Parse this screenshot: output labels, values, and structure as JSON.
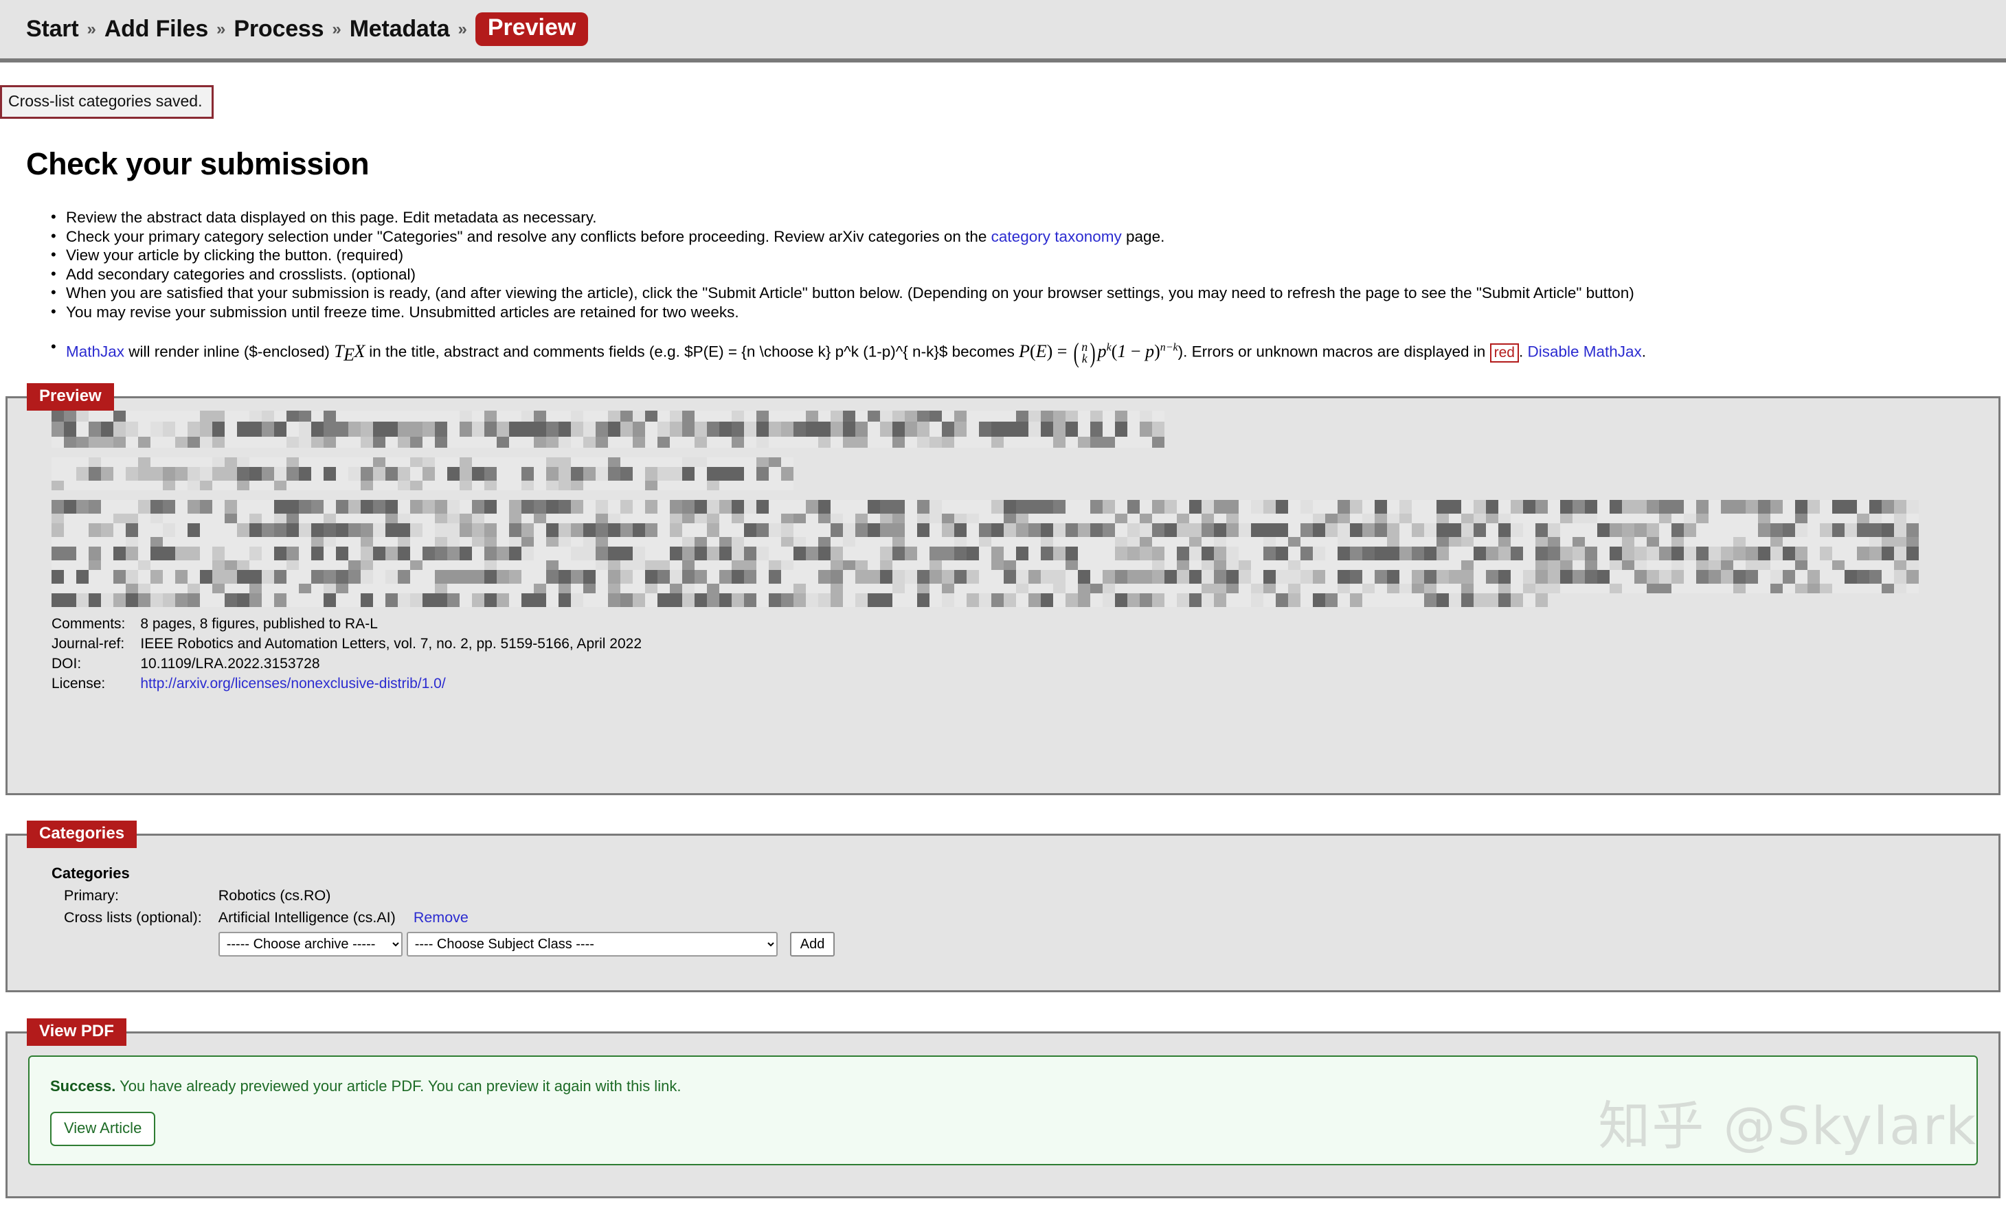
{
  "nav": {
    "separator": "»",
    "steps": [
      {
        "label": "Start",
        "current": false
      },
      {
        "label": "Add Files",
        "current": false
      },
      {
        "label": "Process",
        "current": false
      },
      {
        "label": "Metadata",
        "current": false
      },
      {
        "label": "Preview",
        "current": true
      }
    ]
  },
  "flash": {
    "message": "Cross-list categories saved."
  },
  "page": {
    "title": "Check your submission"
  },
  "instructions": {
    "b1": "Review the abstract data displayed on this page. Edit metadata as necessary.",
    "b2_a": "Check your primary category selection under \"Categories\" and resolve any conflicts before proceeding. Review arXiv categories on the ",
    "b2_link": "category taxonomy",
    "b2_b": " page.",
    "b3": "View your article by clicking the button. (required)",
    "b4": "Add secondary categories and crosslists. (optional)",
    "b5": "When you are satisfied that your submission is ready, (and after viewing the article), click the \"Submit Article\" button below. (Depending on your browser settings, you may need to refresh the page to see the \"Submit Article\" button)",
    "b6": "You may revise your submission until freeze time. Unsubmitted articles are retained for two weeks.",
    "b7_link": "MathJax",
    "b7_a": " will render inline ($-enclosed) ",
    "b7_tex": "TEX",
    "b7_b": " in the title, abstract and comments fields (e.g. $P(E) = {n \\choose k} p^k (1-p)^{ n-k}$ becomes ",
    "b7_formula": "P(E) = (n k) p^k (1 - p)^(n-k)",
    "b7_c": "). Errors or unknown macros are displayed in ",
    "b7_red": "red",
    "b7_d": ". ",
    "b7_link2": "Disable MathJax",
    "b7_e": "."
  },
  "preview_panel": {
    "legend": "Preview",
    "redacted_note": "abstract and title content is pixelated / redacted",
    "metadata": [
      {
        "label": "Comments:",
        "value": "8 pages, 8 figures, published to RA-L",
        "is_link": false
      },
      {
        "label": "Journal-ref:",
        "value": "IEEE Robotics and Automation Letters, vol. 7, no. 2, pp. 5159-5166, April 2022",
        "is_link": false
      },
      {
        "label": "DOI:",
        "value": "10.1109/LRA.2022.3153728",
        "is_link": false
      },
      {
        "label": "License:",
        "value": "http://arxiv.org/licenses/nonexclusive-distrib/1.0/",
        "is_link": true
      }
    ]
  },
  "categories_panel": {
    "legend": "Categories",
    "heading": "Categories",
    "primary_label": "Primary:",
    "primary_value": "Robotics (cs.RO)",
    "crosslist_label": "Cross lists (optional):",
    "crosslist_value": "Artificial Intelligence (cs.AI)",
    "remove_label": "Remove",
    "archive_select": "----- Choose archive -----",
    "subject_select": "---- Choose Subject Class ----",
    "add_label": "Add"
  },
  "viewpdf_panel": {
    "legend": "View PDF",
    "success_strong": "Success.",
    "success_text": " You have already previewed your article PDF. You can preview it again with this link.",
    "view_article_label": "View Article"
  },
  "watermark": {
    "text": "知乎 @Skylark"
  },
  "colors": {
    "accent_red": "#b31b1b",
    "panel_bg": "#e4e4e4",
    "panel_border": "#7a7a7a",
    "link_blue": "#2b2bd0",
    "success_green": "#2e7d32"
  }
}
